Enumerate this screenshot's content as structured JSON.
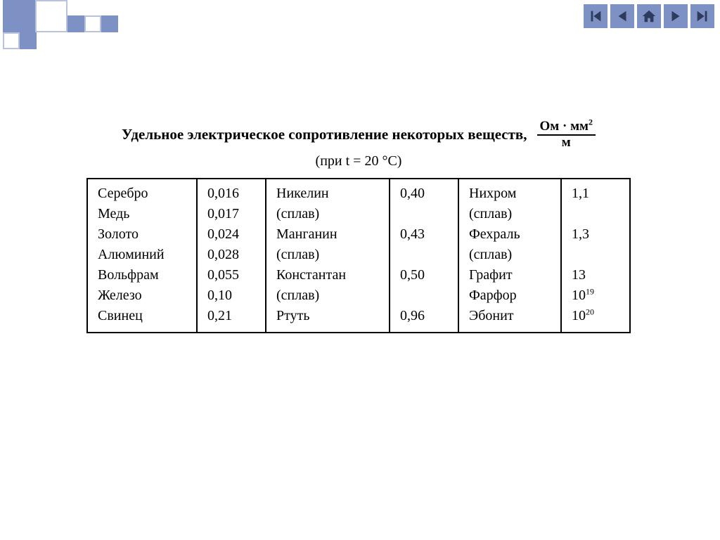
{
  "title": {
    "main": "Удельное электрическое сопротивление некоторых веществ,",
    "unit_num": "Ом · мм",
    "unit_exp": "2",
    "unit_den": "м",
    "condition": "(при  t = 20 °C)"
  },
  "columns": [
    {
      "materials": [
        "Серебро",
        "Медь",
        "Золото",
        "Алюминий",
        "Вольфрам",
        "Железо",
        "Свинец"
      ],
      "values": [
        "0,016",
        "0,017",
        "0,024",
        "0,028",
        "0,055",
        "0,10",
        "0,21"
      ]
    },
    {
      "materials": [
        "Никелин",
        "(сплав)",
        "Манганин",
        "(сплав)",
        "Константан",
        "(сплав)",
        "Ртуть"
      ],
      "values": [
        "0,40",
        "",
        "0,43",
        "",
        "0,50",
        "",
        "0,96"
      ]
    },
    {
      "materials": [
        "Нихром",
        "(сплав)",
        "Фехраль",
        "(сплав)",
        "Графит",
        "Фарфор",
        "Эбонит"
      ],
      "values": [
        "1,1",
        "",
        "1,3",
        "",
        "13",
        "10",
        "10"
      ],
      "exps": [
        "",
        "",
        "",
        "",
        "",
        "19",
        "20"
      ]
    }
  ],
  "nav": {
    "first": "first-icon",
    "prev": "prev-icon",
    "home": "home-icon",
    "next": "next-icon",
    "last": "last-icon"
  },
  "chart_data": {
    "type": "table",
    "title": "Удельное электрическое сопротивление некоторых веществ, Ом·мм²/м (при t = 20 °C)",
    "unit": "Ом·мм²/м",
    "rows": [
      {
        "material": "Серебро",
        "value": 0.016
      },
      {
        "material": "Медь",
        "value": 0.017
      },
      {
        "material": "Золото",
        "value": 0.024
      },
      {
        "material": "Алюминий",
        "value": 0.028
      },
      {
        "material": "Вольфрам",
        "value": 0.055
      },
      {
        "material": "Железо",
        "value": 0.1
      },
      {
        "material": "Свинец",
        "value": 0.21
      },
      {
        "material": "Никелин (сплав)",
        "value": 0.4
      },
      {
        "material": "Манганин (сплав)",
        "value": 0.43
      },
      {
        "material": "Константан (сплав)",
        "value": 0.5
      },
      {
        "material": "Ртуть",
        "value": 0.96
      },
      {
        "material": "Нихром (сплав)",
        "value": 1.1
      },
      {
        "material": "Фехраль (сплав)",
        "value": 1.3
      },
      {
        "material": "Графит",
        "value": 13
      },
      {
        "material": "Фарфор",
        "value": 1e+19,
        "display": "10^19"
      },
      {
        "material": "Эбонит",
        "value": 1e+20,
        "display": "10^20"
      }
    ]
  }
}
